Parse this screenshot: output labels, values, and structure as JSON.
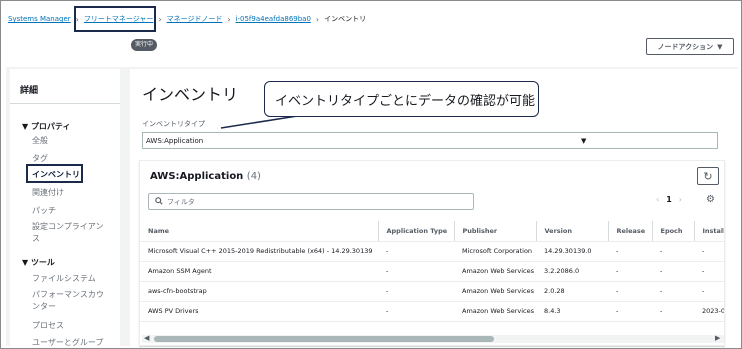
{
  "breadcrumb": {
    "items": [
      "Systems Manager",
      "フリートマネージャー",
      "マネージドノード",
      "i-05f9a4eafda869ba0",
      "インベントリ"
    ]
  },
  "status_badge": "実行中",
  "node_action": {
    "label": "ノードアクション",
    "icon": "caret-down-icon"
  },
  "sidebar": {
    "title": "詳細",
    "sections": [
      {
        "label": "▼ プロパティ",
        "items": [
          "全般",
          "タグ",
          "インベントリ",
          "関連付け",
          "パッチ",
          "設定コンプライアンス"
        ]
      },
      {
        "label": "▼ ツール",
        "items": [
          "ファイルシステム",
          "パフォーマンスカウンター",
          "プロセス",
          "ユーザーとグループ"
        ]
      }
    ],
    "active_item": "インベントリ"
  },
  "main": {
    "title": "インベントリ",
    "type_label": "インベントリタイプ",
    "type_value": "AWS:Application",
    "callout": "イベントリタイプごとにデータの確認が可能"
  },
  "panel": {
    "title": "AWS:Application",
    "count": "(4)",
    "filter_placeholder": "フィルタ",
    "page": "1",
    "columns": [
      "Name",
      "Application Type",
      "Publisher",
      "Version",
      "Release",
      "Epoch",
      "Installe"
    ],
    "rows": [
      [
        "Microsoft Visual C++ 2015-2019 Redistributable (x64) - 14.29.30139",
        "-",
        "Microsoft Corporation",
        "14.29.30139.0",
        "-",
        "-",
        "-"
      ],
      [
        "Amazon SSM Agent",
        "-",
        "Amazon Web Services",
        "3.2.2086.0",
        "-",
        "-",
        "-"
      ],
      [
        "aws-cfn-bootstrap",
        "-",
        "Amazon Web Services",
        "2.0.28",
        "-",
        "-",
        "-"
      ],
      [
        "AWS PV Drivers",
        "-",
        "Amazon Web Services",
        "8.4.3",
        "-",
        "-",
        "2023-0"
      ]
    ]
  },
  "colors": {
    "link": "#0073bb",
    "annotation": "#1b2a4a",
    "badge": "#545b64"
  }
}
